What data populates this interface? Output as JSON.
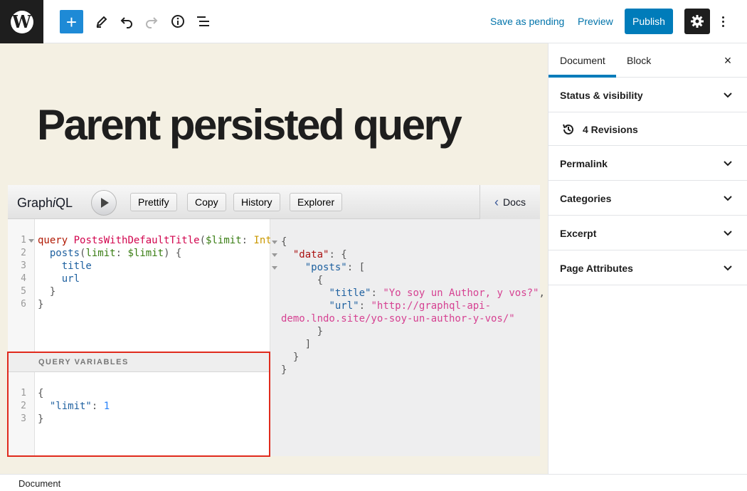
{
  "toolbar": {
    "add_label": "+",
    "save_pending": "Save as pending",
    "preview": "Preview",
    "publish": "Publish"
  },
  "post": {
    "title": "Parent persisted query"
  },
  "graphiql": {
    "logo_prefix": "Graph",
    "logo_i": "i",
    "logo_suffix": "QL",
    "buttons": [
      "Prettify",
      "Copy",
      "History",
      "Explorer"
    ],
    "docs": "Docs",
    "query_lines": [
      "query PostsWithDefaultTitle($limit: Int) {",
      "  posts(limit: $limit) {",
      "    title",
      "    url",
      "  }",
      "}"
    ],
    "query_variables_title": "QUERY VARIABLES",
    "variables_lines": [
      "{",
      "  \"limit\": 1",
      "}"
    ],
    "result_lines": [
      "{",
      "  \"data\": {",
      "    \"posts\": [",
      "      {",
      "        \"title\": \"Yo soy un Author, y vos?\",",
      "        \"url\": \"http://graphql-api-",
      "demo.lndo.site/yo-soy-un-author-y-vos/\"",
      "      }",
      "    ]",
      "  }",
      "}"
    ]
  },
  "sidebar": {
    "tabs": [
      "Document",
      "Block"
    ],
    "close": "×",
    "revisions": "4 Revisions",
    "panels": [
      "Status & visibility",
      "Permalink",
      "Categories",
      "Excerpt",
      "Page Attributes"
    ]
  },
  "footer": {
    "breadcrumb": "Document"
  },
  "colors": {
    "accent": "#007cba",
    "canvas": "#f4f0e3",
    "highlight": "#e02a1c"
  }
}
